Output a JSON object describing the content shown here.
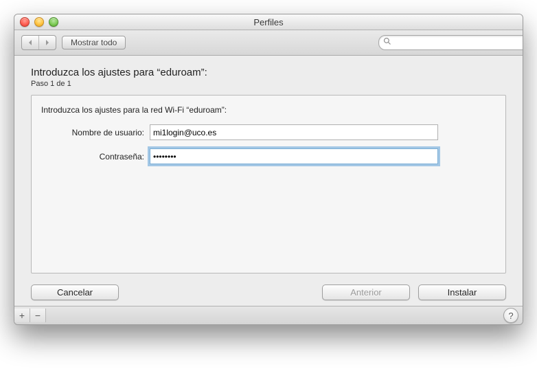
{
  "window": {
    "title": "Perfiles"
  },
  "toolbar": {
    "show_all_label": "Mostrar todo",
    "search_placeholder": ""
  },
  "main": {
    "heading": "Introduzca los ajustes para “eduroam”:",
    "step": "Paso 1 de 1",
    "panel_instruction": "Introduzca los ajustes para la red Wi-Fi “eduroam”:",
    "username_label": "Nombre de usuario:",
    "username_value": "mi1login@uco.es",
    "password_label": "Contraseña:",
    "password_value": "••••••••"
  },
  "buttons": {
    "cancel": "Cancelar",
    "previous": "Anterior",
    "install": "Instalar"
  },
  "footer": {
    "add": "+",
    "remove": "−",
    "help": "?"
  }
}
